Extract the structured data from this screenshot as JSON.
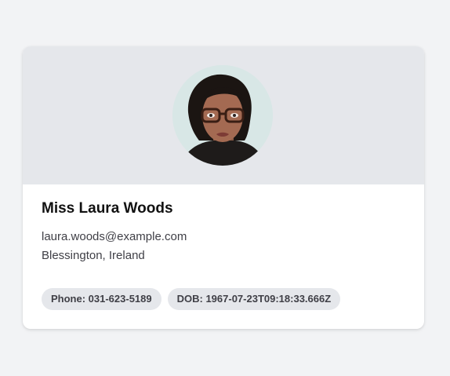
{
  "profile": {
    "name": "Miss Laura Woods",
    "email": "laura.woods@example.com",
    "location": "Blessington, Ireland",
    "avatar_alt": "profile-photo",
    "chips": {
      "phone": "Phone: 031-623-5189",
      "dob": "DOB: 1967-07-23T09:18:33.666Z"
    }
  },
  "colors": {
    "page_background": "#f2f3f5",
    "header_background": "#e5e7eb",
    "chip_background": "#e5e7eb",
    "text_primary": "#111111",
    "text_secondary": "#3f3f46"
  }
}
